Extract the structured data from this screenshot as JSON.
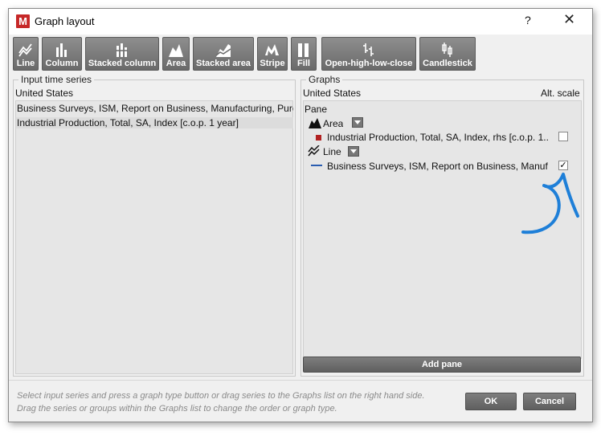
{
  "window": {
    "title": "Graph layout",
    "logo_letter": "M",
    "help": "?",
    "close": "✕"
  },
  "toolbar": {
    "buttons": [
      {
        "label": "Line",
        "icon": "line-chart-icon"
      },
      {
        "label": "Column",
        "icon": "column-chart-icon"
      },
      {
        "label": "Stacked column",
        "icon": "stacked-column-icon"
      },
      {
        "label": "Area",
        "icon": "area-chart-icon"
      },
      {
        "label": "Stacked area",
        "icon": "stacked-area-icon"
      },
      {
        "label": "Stripe",
        "icon": "stripe-chart-icon"
      },
      {
        "label": "Fill",
        "icon": "fill-chart-icon"
      },
      {
        "label": "Open-high-low-close",
        "icon": "ohlc-icon"
      },
      {
        "label": "Candlestick",
        "icon": "candlestick-icon"
      }
    ]
  },
  "input_series": {
    "title": "Input time series",
    "group_header": "United States",
    "items": [
      "Business Surveys, ISM, Report on Business, Manufacturing, Purc...",
      "Industrial Production, Total, SA, Index [c.o.p. 1 year]"
    ]
  },
  "graphs": {
    "title": "Graphs",
    "group_header": "United States",
    "alt_scale_label": "Alt. scale",
    "pane_label": "Pane",
    "area_group": {
      "label": "Area",
      "series": "Industrial Production, Total, SA, Index, rhs [c.o.p. 1...",
      "alt_checked": false,
      "color": "#b22222"
    },
    "line_group": {
      "label": "Line",
      "series": "Business Surveys, ISM, Report on Business, Manuf...",
      "alt_checked": true,
      "checkmark": "✓",
      "color": "#2a5db0"
    },
    "add_pane_label": "Add pane"
  },
  "footer": {
    "hint_line1": "Select input series and press a graph type button or drag series to the Graphs list on the right hand side.",
    "hint_line2": "Drag the series or groups within the Graphs list to change the order or graph type.",
    "ok_label": "OK",
    "cancel_label": "Cancel"
  },
  "annotation": {
    "color": "#1e7fd8"
  }
}
